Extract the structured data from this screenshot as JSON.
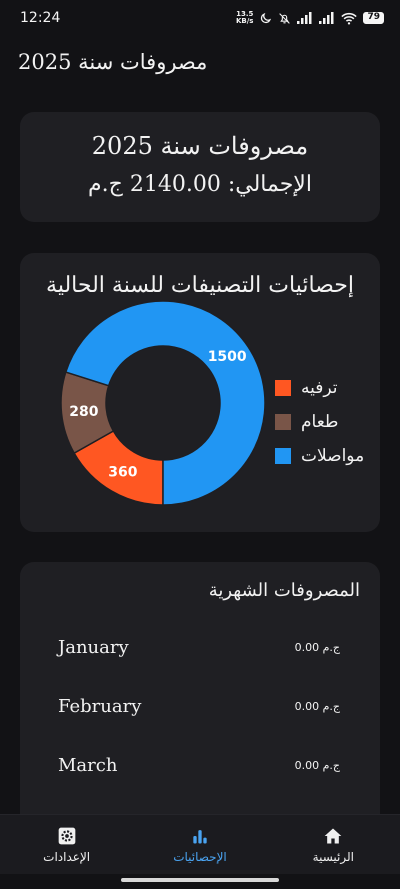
{
  "status_bar": {
    "time": "12:24",
    "net_speed_value": "13.5",
    "net_speed_unit": "KB/s",
    "battery": "79"
  },
  "app_bar": {
    "title": "مصروفات سنة 2025"
  },
  "summary": {
    "title": "مصروفات سنة 2025",
    "total": "الإجمالي: 2140.00 ج.م"
  },
  "stats": {
    "title": "إحصائيات التصنيفات للسنة الحالية"
  },
  "chart_data": {
    "type": "pie",
    "categories": [
      "ترفيه",
      "طعام",
      "مواصلات"
    ],
    "values": [
      360,
      280,
      1500
    ],
    "data_labels": [
      "360",
      "280",
      "1500"
    ],
    "colors": [
      "#ff5722",
      "#795548",
      "#2196f3"
    ],
    "legend_position": "right"
  },
  "monthly": {
    "title": "المصروفات الشهرية",
    "rows": [
      {
        "month": "January",
        "amount": "ج.م 0.00"
      },
      {
        "month": "February",
        "amount": "ج.م 0.00"
      },
      {
        "month": "March",
        "amount": "ج.م 0.00"
      }
    ]
  },
  "nav": {
    "items": [
      {
        "label": "الإعدادات",
        "icon": "gear-icon"
      },
      {
        "label": "الإحصائيات",
        "icon": "bar-chart-icon"
      },
      {
        "label": "الرئيسية",
        "icon": "home-icon"
      }
    ]
  },
  "colors": {
    "accent": "#4aa3f0",
    "background": "#121215",
    "card": "#1f1f23"
  }
}
